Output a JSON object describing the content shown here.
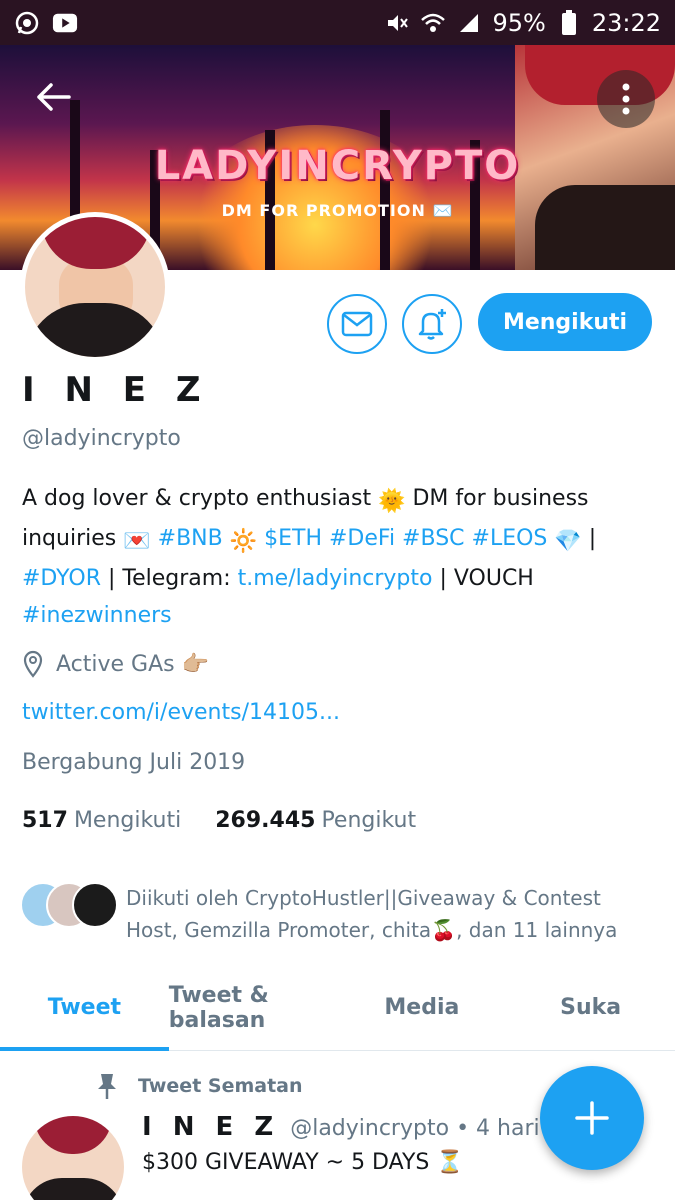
{
  "status_bar": {
    "battery": "95%",
    "time": "23:22",
    "left_icons": [
      "whatsapp-icon",
      "youtube-icon"
    ],
    "right_icons": [
      "mute-icon",
      "wifi-icon",
      "signal-icon",
      "battery-icon"
    ]
  },
  "banner": {
    "title": "LADYINCRYPTO",
    "subtitle": "DM FOR PROMOTION ✉️"
  },
  "profile": {
    "name": "I N E Z",
    "handle": "@ladyincrypto",
    "bio": {
      "p1": "A dog lover & crypto enthusiast ",
      "e1": "🌞",
      "p2": " DM for business inquiries ",
      "e2": "💌",
      "t1": " #BNB",
      "e3": "🔆",
      "t2": "  $ETH #DeFi #BSC #LEOS",
      "e4": "💎",
      "p3": " | ",
      "t3": "#DYOR",
      "p4": " | Telegram: ",
      "t4": "t.me/ladyincrypto",
      "p5": " | VOUCH ",
      "t5": "#inezwinners"
    },
    "location": "Active GAs 👉🏼",
    "url": "twitter.com/i/events/14105...",
    "joined": "Bergabung Juli 2019",
    "following_count": "517",
    "following_label": "Mengikuti",
    "followers_count": "269.445",
    "followers_label": "Pengikut",
    "followed_by": "Diikuti oleh CryptoHustler||Giveaway & Contest Host, Gemzilla Promoter, chita🍒, dan 11 lainnya"
  },
  "actions": {
    "follow_label": "Mengikuti"
  },
  "tabs": [
    {
      "label": "Tweet",
      "active": true
    },
    {
      "label": "Tweet & balasan",
      "active": false
    },
    {
      "label": "Media",
      "active": false
    },
    {
      "label": "Suka",
      "active": false
    }
  ],
  "pinned_tweet": {
    "pin_label": "Tweet Sematan",
    "author_name": "I N E Z",
    "author_handle": "@ladyincrypto",
    "time": "• 4 hari",
    "text": "$300 GIVEAWAY ~ 5 DAYS ⏳"
  },
  "colors": {
    "accent": "#1da1f2",
    "secondary_text": "#657786",
    "primary_text": "#14171a"
  }
}
